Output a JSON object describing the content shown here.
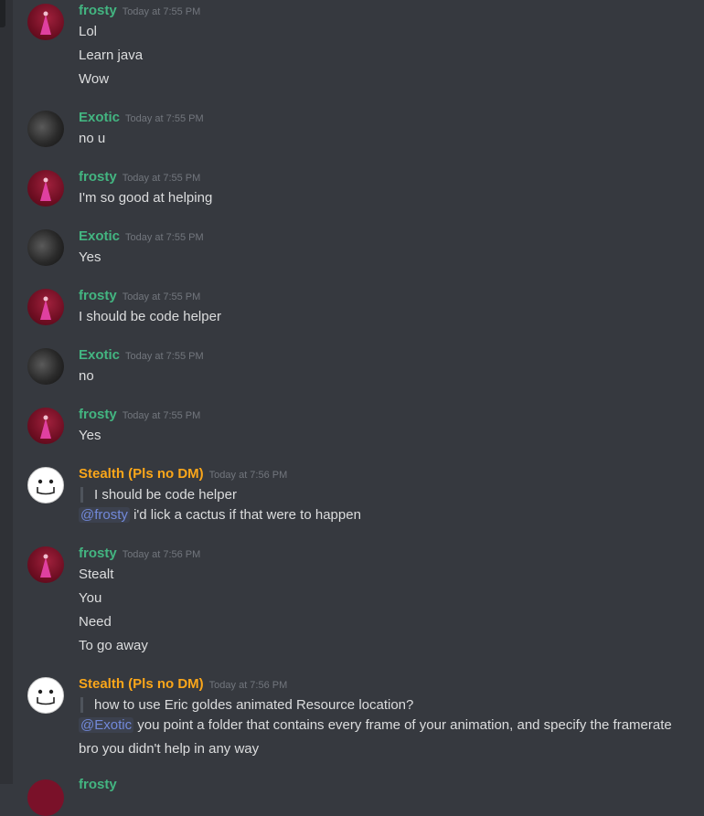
{
  "colors": {
    "frosty": "#43b581",
    "exotic": "#43b581",
    "stealth": "#faa61a",
    "mention": "#7289da",
    "background": "#36393f"
  },
  "messages": [
    {
      "author": "frosty",
      "timestamp": "Today at 7:55 PM",
      "lines": [
        "Lol",
        "Learn java",
        "Wow"
      ]
    },
    {
      "author": "Exotic",
      "timestamp": "Today at 7:55 PM",
      "lines": [
        "no u"
      ]
    },
    {
      "author": "frosty",
      "timestamp": "Today at 7:55 PM",
      "lines": [
        "I'm so good at helping"
      ]
    },
    {
      "author": "Exotic",
      "timestamp": "Today at 7:55 PM",
      "lines": [
        "Yes"
      ]
    },
    {
      "author": "frosty",
      "timestamp": "Today at 7:55 PM",
      "lines": [
        "I should be code helper"
      ]
    },
    {
      "author": "Exotic",
      "timestamp": "Today at 7:55 PM",
      "lines": [
        "no"
      ]
    },
    {
      "author": "frosty",
      "timestamp": "Today at 7:55 PM",
      "lines": [
        "Yes"
      ]
    },
    {
      "author": "Stealth (Pls no DM)",
      "timestamp": "Today at 7:56 PM",
      "quote": "I should be code helper",
      "mention": "@frosty",
      "reply": "i'd lick a cactus if that were to happen"
    },
    {
      "author": "frosty",
      "timestamp": "Today at 7:56 PM",
      "lines": [
        "Stealt",
        "You",
        "Need",
        "To go away"
      ]
    },
    {
      "author": "Stealth (Pls no DM)",
      "timestamp": "Today at 7:56 PM",
      "quote": "how to use Eric goldes animated Resource location?",
      "mention": "@Exotic",
      "reply": "you point a folder that contains every frame of your animation, and specify the framerate",
      "extra": "bro you didn't help in any way"
    }
  ],
  "next_author": "frosty"
}
